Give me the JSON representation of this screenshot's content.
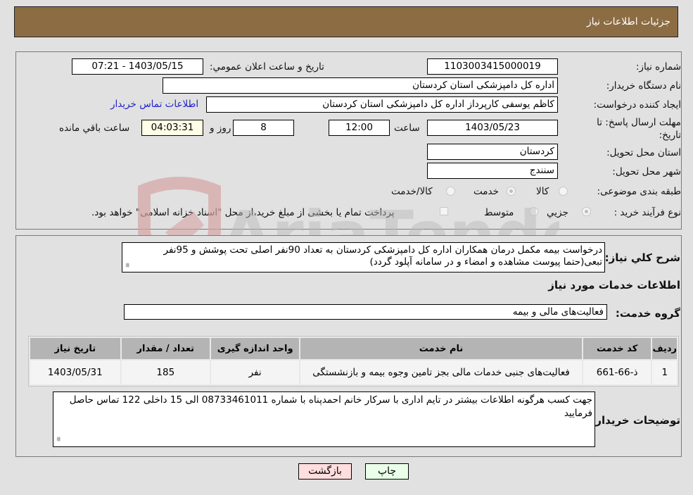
{
  "header": {
    "title": "جزئیات اطلاعات نیاز"
  },
  "form": {
    "need_number": {
      "label": "شماره نیاز:",
      "value": "1103003415000019"
    },
    "announce_datetime": {
      "label": "تاریخ و ساعت اعلان عمومي:",
      "value": "1403/05/15 - 07:21"
    },
    "buyer_org": {
      "label": "نام دستگاه خریدار:",
      "value": "اداره کل دامپزشکی استان کردستان"
    },
    "requester": {
      "label": "ایجاد کننده درخواست:",
      "value": "کاظم یوسفی کارپرداز اداره کل دامپزشکی استان کردستان"
    },
    "buyer_contact_link": "اطلاعات تماس خریدار",
    "deadline": {
      "label_line1": "مهلت ارسال پاسخ: تا",
      "label_line2": "تاریخ:",
      "date": "1403/05/23",
      "time_label": "ساعت",
      "time": "12:00",
      "days": "8",
      "days_label": "روز و",
      "remaining": "04:03:31",
      "remaining_label": "ساعت باقي مانده"
    },
    "delivery_province": {
      "label": "استان محل تحویل:",
      "value": "کردستان"
    },
    "delivery_city": {
      "label": "شهر محل تحویل:",
      "value": "سنندج"
    },
    "category": {
      "label": "طبقه بندی موضوعی:",
      "options": [
        "کالا",
        "خدمت",
        "کالا/خدمت"
      ],
      "selected": "خدمت"
    },
    "purchase_type": {
      "label": "نوع فرآیند خرید :",
      "options": [
        "جزيي",
        "متوسط"
      ],
      "selected": "جزيي",
      "treasury_note": "پرداخت تمام یا بخشی از مبلغ خرید،از محل \"اسناد خزانه اسلامی\" خواهد بود."
    }
  },
  "description": {
    "label": "شرح كلي نياز:",
    "value": "درخواست بیمه مکمل درمان همکاران اداره کل دامپزشکی کردستان به تعداد 90نفر اصلی تحت پوشش و 95نفر تبعی(حتما پیوست مشاهده و امضاء و در سامانه آپلود گردد)"
  },
  "services": {
    "section_title": "اطلاعات خدمات مورد نیاز",
    "group_label": "گروه خدمت:",
    "group_value": "فعالیت‌های مالی و بیمه",
    "columns": [
      "ردیف",
      "کد خدمت",
      "نام خدمت",
      "واحد اندازه گیری",
      "تعداد / مقدار",
      "تاریخ نیاز"
    ],
    "rows": [
      [
        "1",
        "ذ-66-661",
        "فعالیت‌های جنبی خدمات مالی بجز تامین وجوه بیمه و بازنشستگی",
        "نفر",
        "185",
        "1403/05/31"
      ]
    ]
  },
  "buyer_notes": {
    "label": "توضیحات خریدار:",
    "value": "جهت کسب هرگونه اطلاعات بیشتر در تایم اداری با سرکار خانم احمدپناه با شماره 08733461011 الی 15 داخلی 122 تماس حاصل فرمایید"
  },
  "buttons": {
    "print": "چاپ",
    "back": "بازگشت"
  },
  "watermark": {
    "text": "AriaTender.neT"
  },
  "colors": {
    "header_bg": "#8c6c42",
    "back_btn_bg": "#ffdede",
    "print_btn_bg": "#eaffea",
    "link": "#2222cc",
    "table_header": "#b4b4b4"
  }
}
